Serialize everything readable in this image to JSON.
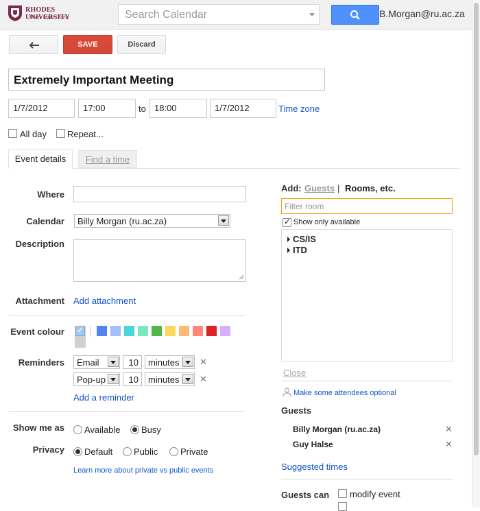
{
  "header": {
    "logo_name": "RHODES UNIVERSITY",
    "logo_tagline": "Where leaders learn",
    "search_placeholder": "Search Calendar",
    "user_email": "B.Morgan@ru.ac.za"
  },
  "toolbar": {
    "save_label": "SAVE",
    "discard_label": "Discard"
  },
  "event": {
    "title": "Extremely Important Meeting",
    "start_date": "1/7/2012",
    "start_time": "17:00",
    "to_label": "to",
    "end_time": "18:00",
    "end_date": "1/7/2012",
    "time_zone_label": "Time zone",
    "all_day_label": "All day",
    "repeat_label": "Repeat..."
  },
  "tabs": {
    "details": "Event details",
    "find_time": "Find a time"
  },
  "details": {
    "where_label": "Where",
    "where_value": "",
    "calendar_label": "Calendar",
    "calendar_value": "Billy Morgan (ru.ac.za)",
    "description_label": "Description",
    "attachment_label": "Attachment",
    "add_attachment": "Add attachment",
    "event_colour_label": "Event colour",
    "colours": [
      "#5484ed",
      "#a4bdfc",
      "#46d6db",
      "#7ae7bf",
      "#51b749",
      "#fbd75b",
      "#ffb878",
      "#ff887c",
      "#dc2127",
      "#dbadff"
    ],
    "reminders_label": "Reminders",
    "reminders": [
      {
        "method": "Email",
        "amount": "10",
        "unit": "minutes"
      },
      {
        "method": "Pop-up",
        "amount": "10",
        "unit": "minutes"
      }
    ],
    "add_reminder": "Add a reminder",
    "show_me_as_label": "Show me as",
    "available_label": "Available",
    "busy_label": "Busy",
    "privacy_label": "Privacy",
    "default_label": "Default",
    "public_label": "Public",
    "private_label": "Private",
    "privacy_link": "Learn more about private vs public events"
  },
  "side": {
    "add_label": "Add:",
    "guests_tab": "Guests",
    "separator": "|",
    "rooms_tab": "Rooms, etc.",
    "filter_placeholder": "Filter room",
    "show_only_available": "Show only available",
    "rooms": [
      "CS/IS",
      "ITD"
    ],
    "close_label": "Close",
    "optional_link": "Make some attendees optional",
    "guests_heading": "Guests",
    "guests": [
      "Billy Morgan (ru.ac.za)",
      "Guy Halse"
    ],
    "suggested_times": "Suggested times",
    "guests_can_label": "Guests can",
    "modify_event": "modify event"
  }
}
